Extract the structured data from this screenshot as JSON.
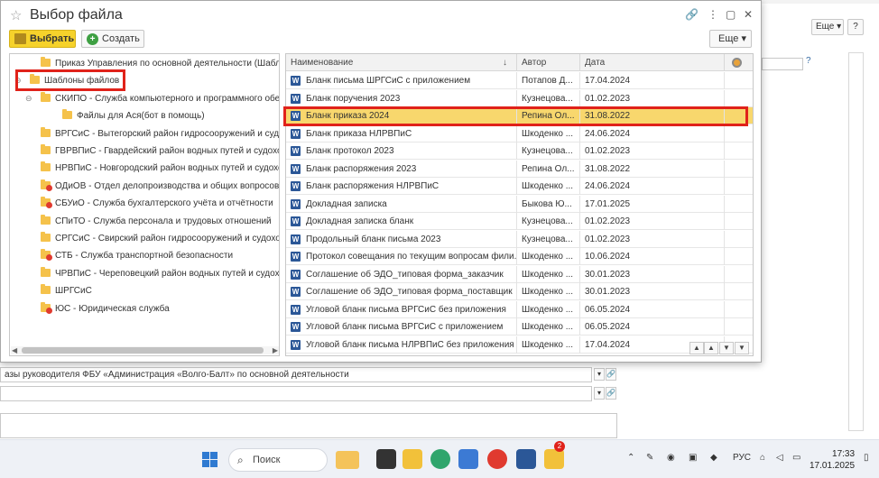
{
  "dialog": {
    "title": "Выбор файла",
    "toolbar": {
      "select_label": "Выбрать",
      "create_label": "Создать",
      "more_label": "Еще",
      "more_arrow": "▾"
    },
    "window_controls": {
      "link": "🔗",
      "menu": "⋮",
      "minimize": "▢",
      "close": "✕"
    }
  },
  "tree": {
    "items": [
      {
        "label": "Приказ Управления по основной деятельности (Шаблон до",
        "indent": 1,
        "folder": "plain"
      },
      {
        "label": "Шаблоны файлов",
        "indent": 0,
        "folder": "plain",
        "expander": "⊖"
      },
      {
        "label": "СКИПО - Служба компьютерного и программного обеспе",
        "indent": 1,
        "folder": "plain",
        "expander": "⊖"
      },
      {
        "label": "Файлы для Ася(бот в помощь)",
        "indent": 2,
        "folder": "plain"
      },
      {
        "label": "ВРГСиС - Вытегорский район гидросооружений и судохо",
        "indent": 1,
        "folder": "plain"
      },
      {
        "label": "ГВРВПиС - Гвардейский район водных путей и судоходст",
        "indent": 1,
        "folder": "plain"
      },
      {
        "label": "НРВПиС - Новгородский район водных путей и судоходс",
        "indent": 1,
        "folder": "plain"
      },
      {
        "label": "ОДиОВ - Отдел делопроизводства и общих вопросов",
        "indent": 1,
        "folder": "red"
      },
      {
        "label": "СБУиО - Служба бухгалтерского учёта и отчётности",
        "indent": 1,
        "folder": "red"
      },
      {
        "label": "СПиТО - Служба персонала и трудовых отношений",
        "indent": 1,
        "folder": "plain"
      },
      {
        "label": "СРГСиС - Свирский район гидросооружений и судоходс",
        "indent": 1,
        "folder": "plain"
      },
      {
        "label": "СТБ - Служба транспортной безопасности",
        "indent": 1,
        "folder": "red"
      },
      {
        "label": "ЧРВПиС - Череповецкий район водных путей и судоходс",
        "indent": 1,
        "folder": "plain"
      },
      {
        "label": "ШРГСиС",
        "indent": 1,
        "folder": "plain"
      },
      {
        "label": "ЮС - Юридическая служба",
        "indent": 1,
        "folder": "red"
      }
    ]
  },
  "table": {
    "columns": {
      "name": "Наименование",
      "author": "Автор",
      "date": "Дата",
      "sort_indicator": "↓"
    },
    "rows": [
      {
        "icon": "W",
        "name": "Бланк письма ШРГСиС с приложением",
        "author": "Потапов Д...",
        "date": "17.04.2024"
      },
      {
        "icon": "W",
        "name": "Бланк поручения 2023",
        "author": "Кузнецова...",
        "date": "01.02.2023"
      },
      {
        "icon": "W",
        "name": "Бланк приказа 2024",
        "author": "Репина Ол...",
        "date": "31.08.2022",
        "selected": true
      },
      {
        "icon": "W",
        "name": "Бланк приказа НЛРВПиС",
        "author": "Шкоденко ...",
        "date": "24.06.2024"
      },
      {
        "icon": "W",
        "name": "Бланк протокол 2023",
        "author": "Кузнецова...",
        "date": "01.02.2023"
      },
      {
        "icon": "W",
        "name": "Бланк распоряжения 2023",
        "author": "Репина Ол...",
        "date": "31.08.2022"
      },
      {
        "icon": "W",
        "name": "Бланк распоряжения НЛРВПиС",
        "author": "Шкоденко ...",
        "date": "24.06.2024"
      },
      {
        "icon": "W",
        "name": "Докладная записка",
        "author": "Быкова Ю...",
        "date": "17.01.2025"
      },
      {
        "icon": "W",
        "name": "Докладная записка бланк",
        "author": "Кузнецова...",
        "date": "01.02.2023"
      },
      {
        "icon": "W",
        "name": "Продольный бланк письма 2023",
        "author": "Кузнецова...",
        "date": "01.02.2023"
      },
      {
        "icon": "W",
        "name": "Протокол совещания по текущим вопросам фили...",
        "author": "Шкоденко ...",
        "date": "10.06.2024"
      },
      {
        "icon": "W",
        "name": "Соглашение об ЭДО_типовая форма_заказчик",
        "author": "Шкоденко ...",
        "date": "30.01.2023"
      },
      {
        "icon": "W",
        "name": "Соглашение об ЭДО_типовая форма_поставщик",
        "author": "Шкоденко ...",
        "date": "30.01.2023"
      },
      {
        "icon": "W",
        "name": "Угловой бланк письма ВРГСиС без приложения",
        "author": "Шкоденко ...",
        "date": "06.05.2024"
      },
      {
        "icon": "W",
        "name": "Угловой бланк письма ВРГСиС с приложением",
        "author": "Шкоденко ...",
        "date": "06.05.2024"
      },
      {
        "icon": "W",
        "name": "Угловой бланк письма НЛРВПиС без приложения",
        "author": "Шкоденко ...",
        "date": "17.04.2024"
      }
    ],
    "nav": [
      "▲",
      "▲",
      "▼",
      "▼"
    ]
  },
  "background": {
    "more_label": "Еще",
    "more_arrow": "▾",
    "help_label": "?",
    "help_mark": "?",
    "field1_text": "азы руководителя ФБУ «Администрация «Волго-Балт» по основной деятельности",
    "field_dropdown": "▾",
    "field_link": "🔗"
  },
  "taskbar": {
    "search_label": "Поиск",
    "language": "РУС",
    "time": "17:33",
    "date": "17.01.2025",
    "notification_count": "2"
  },
  "colors": {
    "select_button": "#f6d22b",
    "selected_row": "#f8d76d",
    "highlight_border": "#e0221a",
    "folder": "#f5c24b",
    "word_icon": "#2b5797"
  }
}
